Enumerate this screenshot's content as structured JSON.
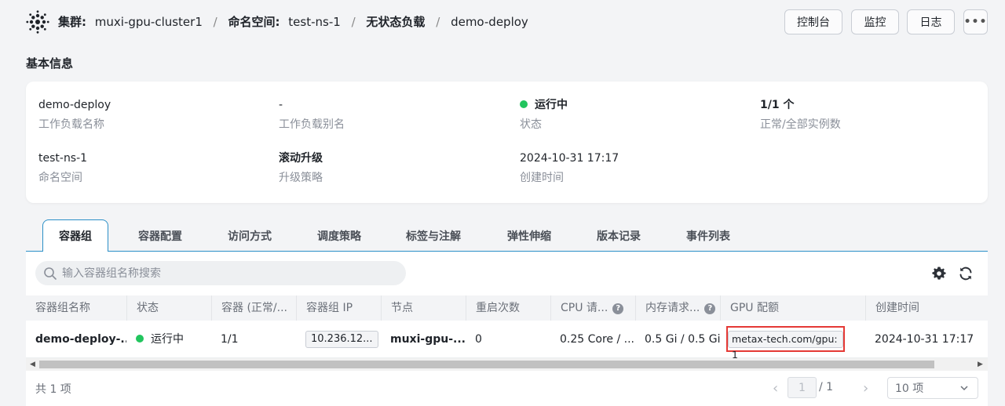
{
  "breadcrumb": {
    "cluster_label": "集群:",
    "cluster_value": "muxi-gpu-cluster1",
    "ns_label": "命名空间:",
    "ns_value": "test-ns-1",
    "workload_type": "无状态负载",
    "workload_name": "demo-deploy",
    "separator": "/"
  },
  "header_buttons": {
    "console": "控制台",
    "monitor": "监控",
    "logs": "日志",
    "more": "•••"
  },
  "basic_info": {
    "title": "基本信息",
    "fields": {
      "name": {
        "value": "demo-deploy",
        "label": "工作负载名称"
      },
      "alias": {
        "value": "-",
        "label": "工作负载别名"
      },
      "status": {
        "value": "运行中",
        "label": "状态"
      },
      "replicas": {
        "value": "1/1 个",
        "label": "正常/全部实例数"
      },
      "namespace": {
        "value": "test-ns-1",
        "label": "命名空间"
      },
      "strategy": {
        "value": "滚动升级",
        "label": "升级策略"
      },
      "created": {
        "value": "2024-10-31 17:17",
        "label": "创建时间"
      }
    }
  },
  "tabs": [
    "容器组",
    "容器配置",
    "访问方式",
    "调度策略",
    "标签与注解",
    "弹性伸缩",
    "版本记录",
    "事件列表"
  ],
  "search": {
    "placeholder": "输入容器组名称搜索"
  },
  "table": {
    "columns": [
      "容器组名称",
      "状态",
      "容器 (正常/...",
      "容器组 IP",
      "节点",
      "重启次数",
      "CPU 请...",
      "内存请求...",
      "GPU 配额",
      "创建时间"
    ],
    "rows": [
      {
        "name": "demo-deploy-...",
        "status": "运行中",
        "containers": "1/1",
        "ip": "10.236.12...",
        "node": "muxi-gpu-...",
        "restarts": "0",
        "cpu": "0.25 Core / ...",
        "memory": "0.5 Gi / 0.5 Gi",
        "gpu": "metax-tech.com/gpu: 1",
        "created": "2024-10-31 17:17"
      }
    ]
  },
  "pagination": {
    "total": "共 1 项",
    "current": "1",
    "of_total": "/ 1",
    "page_size": "10 项"
  },
  "colors": {
    "accent": "#2b8fc7",
    "running": "#22c55e",
    "highlight_border": "#e53935"
  }
}
